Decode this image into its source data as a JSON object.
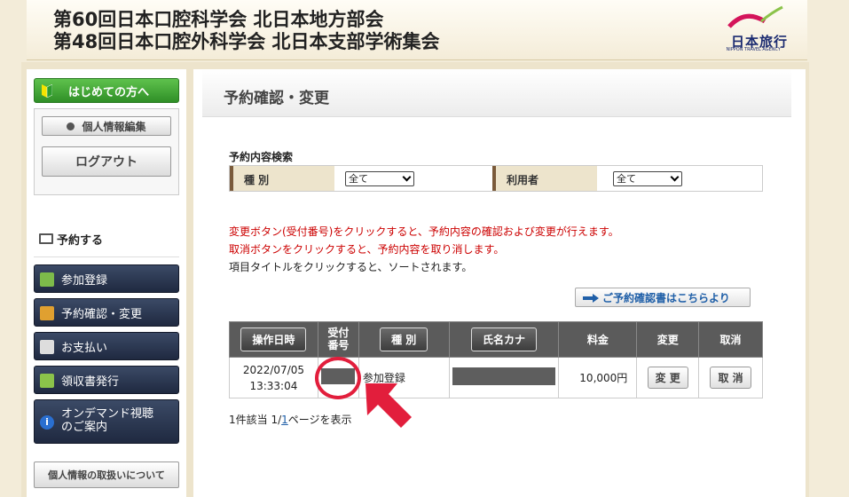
{
  "header": {
    "title_line1": "第60回日本口腔科学会 北日本地方部会",
    "title_line2": "第48回日本口腔外科学会 北日本支部学術集会",
    "logo_text": "日本旅行",
    "logo_sub": "NIPPON TRAVEL AGENCY"
  },
  "sidebar": {
    "first_time": "はじめての方へ",
    "edit_profile": "個人情報編集",
    "logout": "ログアウト",
    "section_title": "予約する",
    "items": [
      {
        "label": "参加登録"
      },
      {
        "label": "予約確認・変更"
      },
      {
        "label": "お支払い"
      },
      {
        "label": "領収書発行"
      },
      {
        "label_line1": "オンデマンド視聴",
        "label_line2": "のご案内"
      }
    ],
    "privacy": "個人情報の取扱いについて"
  },
  "main": {
    "page_title": "予約確認・変更",
    "search": {
      "title": "予約内容検索",
      "type_label": "種 別",
      "type_value": "全て",
      "user_label": "利用者",
      "user_value": "全て"
    },
    "messages": {
      "line1": "変更ボタン(受付番号)をクリックすると、予約内容の確認および変更が行えます。",
      "line2": "取消ボタンをクリックすると、予約内容を取り消します。",
      "line3": "項目タイトルをクリックすると、ソートされます。"
    },
    "confirm_link": "ご予約確認書はこちらより",
    "table": {
      "headers": {
        "datetime": "操作日時",
        "receipt_line1": "受付",
        "receipt_line2": "番号",
        "type": "種 別",
        "name_kana": "氏名カナ",
        "fee": "料金",
        "change": "変更",
        "cancel": "取消"
      },
      "rows": [
        {
          "date": "2022/07/05",
          "time": "13:33:04",
          "type": "参加登録",
          "fee": "10,000円",
          "change_btn": "変 更",
          "cancel_btn": "取 消"
        }
      ]
    },
    "pager": {
      "prefix": "1件該当 1/",
      "page": "1",
      "suffix": "ページを表示"
    }
  }
}
